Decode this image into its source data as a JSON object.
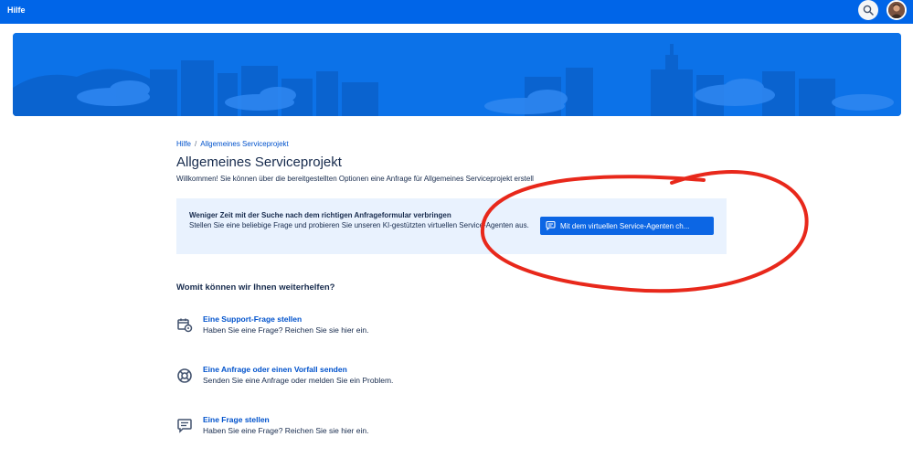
{
  "topbar": {
    "brand": "Hilfe",
    "search_icon": "search-icon",
    "avatar": "user-avatar"
  },
  "colors": {
    "topbar": "#0065e8",
    "banner": "#0c72e8",
    "link": "#0052cc",
    "panel_bg": "#e9f2fe",
    "button": "#0c66e4",
    "annotation": "#e8281b"
  },
  "breadcrumb": {
    "root": "Hilfe",
    "separator": "/",
    "current": "Allgemeines Serviceprojekt"
  },
  "page": {
    "title": "Allgemeines Serviceprojekt",
    "welcome": "Willkommen! Sie können über die bereitgestellten Optionen eine Anfrage für Allgemeines Serviceprojekt erstell"
  },
  "ai_panel": {
    "title": "Weniger Zeit mit der Suche nach dem richtigen Anfrageformular verbringen",
    "description": "Stellen Sie eine beliebige Frage und probieren Sie unseren KI-gestützten virtuellen Service-Agenten aus.",
    "button_label": "Mit dem virtuellen Service-Agenten ch..."
  },
  "help": {
    "heading": "Womit können wir Ihnen weiterhelfen?",
    "items": [
      {
        "title": "Eine Support-Frage stellen",
        "description": "Haben Sie eine Frage? Reichen Sie sie hier ein.",
        "icon": "calendar-gear-icon"
      },
      {
        "title": "Eine Anfrage oder einen Vorfall senden",
        "description": "Senden Sie eine Anfrage oder melden Sie ein Problem.",
        "icon": "lifebuoy-icon"
      },
      {
        "title": "Eine Frage stellen",
        "description": "Haben Sie eine Frage? Reichen Sie sie hier ein.",
        "icon": "chat-bubble-icon"
      }
    ]
  }
}
